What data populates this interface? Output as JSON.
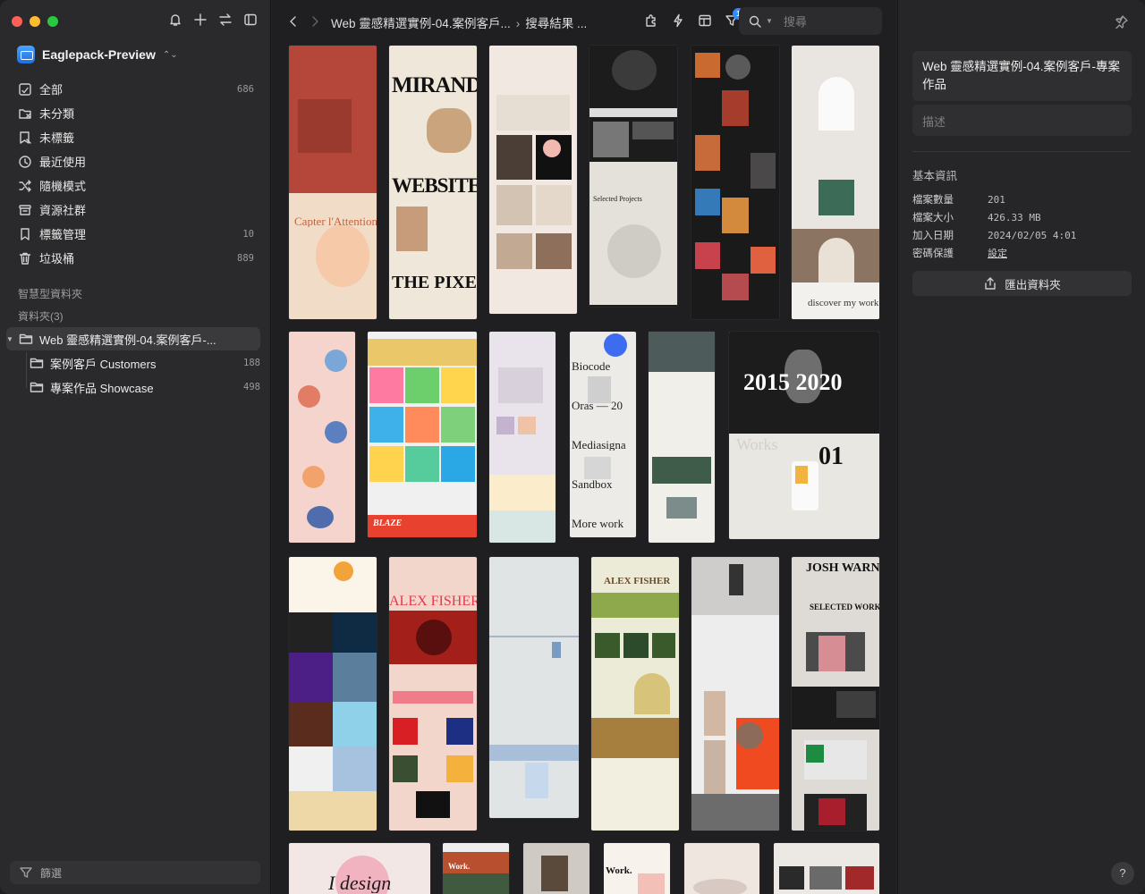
{
  "sidebar": {
    "library_name": "Eaglepack-Preview",
    "nav": [
      {
        "label": "全部",
        "count": "686",
        "icon": "all-items-icon"
      },
      {
        "label": "未分類",
        "count": "",
        "icon": "uncategorized-icon"
      },
      {
        "label": "未標籤",
        "count": "",
        "icon": "untagged-icon"
      },
      {
        "label": "最近使用",
        "count": "",
        "icon": "clock-icon"
      },
      {
        "label": "隨機模式",
        "count": "",
        "icon": "shuffle-icon"
      },
      {
        "label": "資源社群",
        "count": "",
        "icon": "community-icon"
      },
      {
        "label": "標籤管理",
        "count": "10",
        "icon": "bookmark-icon"
      },
      {
        "label": "垃圾桶",
        "count": "889",
        "icon": "trash-icon"
      }
    ],
    "smart_folders_label": "智慧型資料夾",
    "folders_label": "資料夾(3)",
    "folders": [
      {
        "label": "Web 靈感精選實例-04.案例客戶-...",
        "count": ""
      },
      {
        "label": "案例客戶 Customers",
        "count": "188"
      },
      {
        "label": "專案作品 Showcase",
        "count": "498"
      }
    ],
    "filter_label": "篩選"
  },
  "toolbar": {
    "breadcrumb_folder": "Web 靈感精選實例-04.案例客戶...",
    "breadcrumb_current": "搜尋結果 ...",
    "filter_badge": "1",
    "search_placeholder": "搜尋"
  },
  "grid": {
    "thumb_texts": [
      "Capter l'Attention",
      "MIRANDA",
      "WEBSITE",
      "THE PIXEL",
      "Selected Projects",
      "discover my work",
      "Biocode",
      "Oras — 20",
      "Mediasigna",
      "Sandbox",
      "More work",
      "2015 2020",
      "Works",
      "01",
      "ALEX FISHER",
      "JOSH WARNER",
      "SELECTED WORKS",
      "BLAZE",
      "I design",
      "Work."
    ]
  },
  "inspector": {
    "title": "Web 靈感精選實例-04.案例客戶-專案作品",
    "desc_placeholder": "描述",
    "info_title": "基本資訊",
    "rows": [
      {
        "k": "檔案數量",
        "v": "201"
      },
      {
        "k": "檔案大小",
        "v": "426.33 MB"
      },
      {
        "k": "加入日期",
        "v": "2024/02/05 4:01"
      },
      {
        "k": "密碼保護",
        "v": "設定"
      }
    ],
    "export_label": "匯出資料夾",
    "help_label": "?"
  },
  "colors": {
    "accent": "#2f8bff",
    "selection": "#3a3a3d"
  }
}
